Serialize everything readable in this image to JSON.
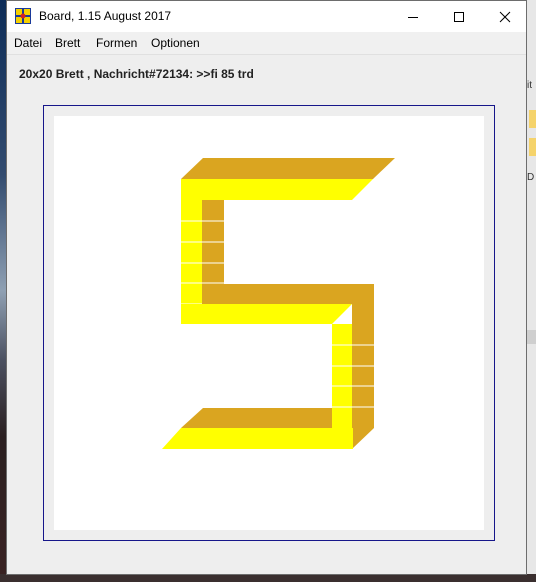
{
  "window": {
    "title": "Board, 1.15 August 2017"
  },
  "menu": {
    "items": [
      "Datei",
      "Brett",
      "Formen",
      "Optionen"
    ]
  },
  "status": {
    "text": "20x20 Brett , Nachricht#72134: >>fi 85 trd"
  },
  "board": {
    "shape": "5",
    "colors": {
      "yellow": "#ffff00",
      "gold": "#daa520",
      "border": "#16168a",
      "canvas": "#ffffff"
    }
  },
  "icons": {
    "app": "board-grid-icon",
    "minimize": "minimize-icon",
    "maximize": "maximize-icon",
    "close": "close-icon"
  },
  "background_fragments": {
    "right_letters": [
      "it",
      "D"
    ]
  }
}
